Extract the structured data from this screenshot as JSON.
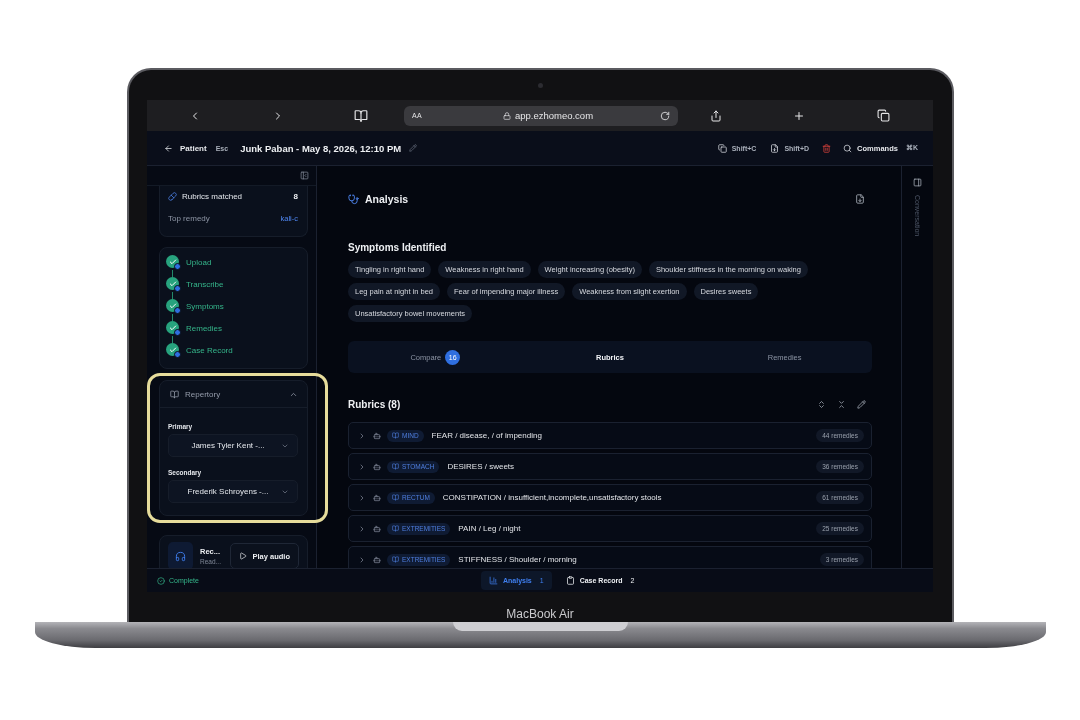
{
  "device": {
    "label": "MacBook Air"
  },
  "browser": {
    "reader_label": "AA",
    "address": "app.ezhomeo.com"
  },
  "header": {
    "back_label": "Patient",
    "back_key": "Esc",
    "title": "Junk Paban - May 8, 2026, 12:10 PM",
    "copy_shortcut": "Shift+C",
    "duplicate_shortcut": "Shift+D",
    "commands_label": "Commands",
    "commands_shortcut": "⌘K"
  },
  "sidebar": {
    "summary": {
      "rubrics_label": "Rubrics matched",
      "rubrics_value": "8",
      "remedy_label": "Top remedy",
      "remedy_value": "kali-c"
    },
    "steps": [
      {
        "label": "Upload",
        "done": true
      },
      {
        "label": "Transcribe",
        "done": true
      },
      {
        "label": "Symptoms",
        "done": true
      },
      {
        "label": "Remedies",
        "done": true
      },
      {
        "label": "Case Record",
        "done": true
      }
    ],
    "repertory": {
      "title": "Repertory",
      "expanded": true,
      "highlighted": true,
      "fields": [
        {
          "label": "Primary",
          "value": "James Tyler Kent -..."
        },
        {
          "label": "Secondary",
          "value": "Frederik Schroyens -..."
        }
      ]
    },
    "audio": {
      "title": "Rec...",
      "subtitle": "Read...",
      "button": "Play audio"
    }
  },
  "analysis": {
    "title": "Analysis",
    "symptoms_title": "Symptoms Identified",
    "symptoms": [
      "Tingling in right hand",
      "Weakness in right hand",
      "Weight increasing (obesity)",
      "Shoulder stiffness in the morning on waking",
      "Leg pain at night in bed",
      "Fear of impending major illness",
      "Weakness from slight exertion",
      "Desires sweets",
      "Unsatisfactory bowel movements"
    ],
    "tabs": [
      {
        "label": "Compare",
        "badge": "16",
        "selected": false
      },
      {
        "label": "Rubrics",
        "selected": true
      },
      {
        "label": "Remedies",
        "selected": false
      }
    ],
    "rubrics_title": "Rubrics (8)",
    "rubrics": [
      {
        "chapter": "MIND",
        "text": "FEAR / disease, / of impending",
        "count": "44 remedies",
        "expanded": false
      },
      {
        "chapter": "STOMACH",
        "text": "DESIRES / sweets",
        "count": "36 remedies",
        "expanded": false
      },
      {
        "chapter": "RECTUM",
        "text": "CONSTIPATION / insufficient,incomplete,unsatisfactory stools",
        "count": "61 remedies",
        "expanded": false
      },
      {
        "chapter": "EXTREMITIES",
        "text": "PAIN / Leg / night",
        "count": "25 remedies",
        "expanded": false
      },
      {
        "chapter": "EXTREMITIES",
        "text": "STIFFNESS / Shoulder / morning",
        "count": "3 remedies",
        "expanded": false
      }
    ]
  },
  "right_rail": {
    "label": "Conversation"
  },
  "status_bar": {
    "status": "Complete",
    "tabs": [
      {
        "label": "Analysis",
        "count": "1",
        "selected": true
      },
      {
        "label": "Case Record",
        "count": "2",
        "selected": false
      }
    ]
  }
}
